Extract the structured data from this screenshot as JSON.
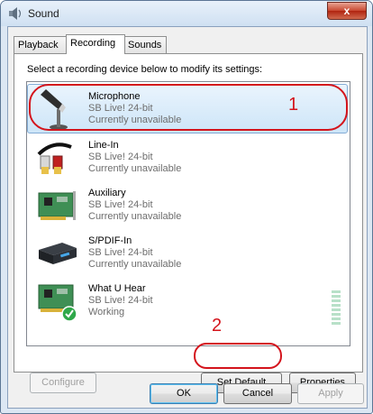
{
  "window": {
    "title": "Sound",
    "close_glyph": "x",
    "tabs": [
      {
        "label": "Playback",
        "active": false
      },
      {
        "label": "Recording",
        "active": true
      },
      {
        "label": "Sounds",
        "active": false
      }
    ]
  },
  "recording": {
    "instruction": "Select a recording device below to modify its settings:",
    "devices": [
      {
        "name": "Microphone",
        "subtitle": "SB Live! 24-bit",
        "status": "Currently unavailable",
        "icon": "microphone-icon",
        "selected": true
      },
      {
        "name": "Line-In",
        "subtitle": "SB Live! 24-bit",
        "status": "Currently unavailable",
        "icon": "rca-cable-icon",
        "selected": false
      },
      {
        "name": "Auxiliary",
        "subtitle": "SB Live! 24-bit",
        "status": "Currently unavailable",
        "icon": "sound-card-icon",
        "selected": false
      },
      {
        "name": "S/PDIF-In",
        "subtitle": "SB Live! 24-bit",
        "status": "Currently unavailable",
        "icon": "spdif-box-icon",
        "selected": false
      },
      {
        "name": "What U Hear",
        "subtitle": "SB Live! 24-bit",
        "status": "Working",
        "icon": "sound-card-default-icon",
        "selected": false
      }
    ],
    "buttons": {
      "configure": "Configure",
      "set_default": "Set Default",
      "properties": "Properties"
    }
  },
  "footer": {
    "ok": "OK",
    "cancel": "Cancel",
    "apply": "Apply"
  },
  "annotations": {
    "marker_1": "1",
    "marker_2": "2",
    "color": "#d4141c"
  },
  "colors": {
    "selection": "#cde5f8",
    "title_bar": "#cfe0f2",
    "close_button": "#c8472f"
  }
}
